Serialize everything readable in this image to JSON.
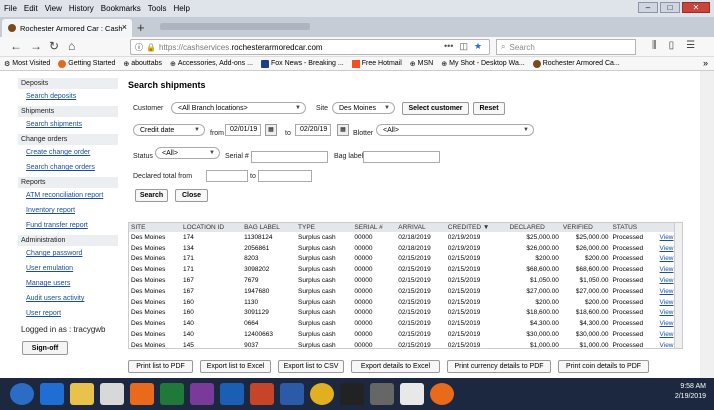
{
  "menubar": [
    "File",
    "Edit",
    "View",
    "History",
    "Bookmarks",
    "Tools",
    "Help"
  ],
  "tab_title": "Rochester Armored Car : Cash",
  "url": {
    "prefix": "https://cashservices.",
    "host": "rochesterarmoredcar.com"
  },
  "search_placeholder": "Search",
  "bookmarks": [
    "Most Visited",
    "Getting Started",
    "abouttabs",
    "Accessories, Add-ons ...",
    "Fox News - Breaking ...",
    "Free Hotmail",
    "MSN",
    "My Shot - Desktop Wa...",
    "Rochester Armored Ca..."
  ],
  "sidebar": {
    "deposits": "Deposits",
    "search_deposits": "Search deposits",
    "shipments": "Shipments",
    "search_shipments": "Search shipments",
    "change_orders": "Change orders",
    "create_change_order": "Create change order",
    "search_change_orders": "Search change orders",
    "reports": "Reports",
    "atm_report": "ATM reconciliation report",
    "inventory_report": "Inventory report",
    "fund_transfer_report": "Fund transfer report",
    "administration": "Administration",
    "change_password": "Change password",
    "user_emulation": "User emulation",
    "manage_users": "Manage users",
    "audit_users": "Audit users activity",
    "user_report": "User report",
    "logged_in": "Logged in as : tracygwb",
    "sign_off": "Sign-off"
  },
  "form": {
    "title": "Search shipments",
    "customer_label": "Customer",
    "customer_value": "<All Branch locations>",
    "site_label": "Site",
    "site_value": "Des Moines",
    "select_customer": "Select customer",
    "reset": "Reset",
    "date_type": "Credit date",
    "from_label": "from",
    "from_value": "02/01/19",
    "to_label": "to",
    "to_value": "02/20/19",
    "blotter_label": "Blotter",
    "blotter_value": "<All>",
    "status_label": "Status",
    "status_value": "<All>",
    "serial_label": "Serial #",
    "bag_label": "Bag label",
    "declared_label": "Declared total from",
    "declared_to": "to",
    "search": "Search",
    "close": "Close"
  },
  "table": {
    "headers": [
      "SITE",
      "LOCATION ID",
      "BAG LABEL",
      "TYPE",
      "SERIAL #",
      "ARRIVAL",
      "CREDITED ▼",
      "DECLARED",
      "VERIFIED",
      "STATUS",
      ""
    ],
    "rows": [
      [
        "Des Moines",
        "174",
        "11308124",
        "Surplus cash",
        "00000",
        "02/18/2019",
        "02/19/2019",
        "$25,000.00",
        "$25,000.00",
        "Processed",
        "View"
      ],
      [
        "Des Moines",
        "134",
        "2056861",
        "Surplus cash",
        "00000",
        "02/18/2019",
        "02/19/2019",
        "$26,000.00",
        "$26,000.00",
        "Processed",
        "View"
      ],
      [
        "Des Moines",
        "171",
        "8203",
        "Surplus cash",
        "00000",
        "02/15/2019",
        "02/15/2019",
        "$200.00",
        "$200.00",
        "Processed",
        "View"
      ],
      [
        "Des Moines",
        "171",
        "3098202",
        "Surplus cash",
        "00000",
        "02/15/2019",
        "02/15/2019",
        "$68,600.00",
        "$68,600.00",
        "Processed",
        "View"
      ],
      [
        "Des Moines",
        "167",
        "7679",
        "Surplus cash",
        "00000",
        "02/15/2019",
        "02/15/2019",
        "$1,050.00",
        "$1,050.00",
        "Processed",
        "View"
      ],
      [
        "Des Moines",
        "167",
        "1947680",
        "Surplus cash",
        "00000",
        "02/15/2019",
        "02/15/2019",
        "$27,000.00",
        "$27,000.00",
        "Processed",
        "View"
      ],
      [
        "Des Moines",
        "160",
        "1130",
        "Surplus cash",
        "00000",
        "02/15/2019",
        "02/15/2019",
        "$200.00",
        "$200.00",
        "Processed",
        "View"
      ],
      [
        "Des Moines",
        "160",
        "3091129",
        "Surplus cash",
        "00000",
        "02/15/2019",
        "02/15/2019",
        "$18,600.00",
        "$18,600.00",
        "Processed",
        "View"
      ],
      [
        "Des Moines",
        "140",
        "0664",
        "Surplus cash",
        "00000",
        "02/15/2019",
        "02/15/2019",
        "$4,300.00",
        "$4,300.00",
        "Processed",
        "View"
      ],
      [
        "Des Moines",
        "140",
        "12400663",
        "Surplus cash",
        "00000",
        "02/15/2019",
        "02/15/2019",
        "$30,000.00",
        "$30,000.00",
        "Processed",
        "View"
      ],
      [
        "Des Moines",
        "145",
        "9037",
        "Surplus cash",
        "00000",
        "02/15/2019",
        "02/15/2019",
        "$1,000.00",
        "$1,000.00",
        "Processed",
        "View"
      ]
    ]
  },
  "bottom_buttons": [
    "Print list to PDF",
    "Export list to Excel",
    "Export list to CSV",
    "Export details to Excel",
    "Print currency details to PDF",
    "Print coin details to PDF"
  ],
  "clock": {
    "time": "9:58 AM",
    "date": "2/19/2019"
  }
}
